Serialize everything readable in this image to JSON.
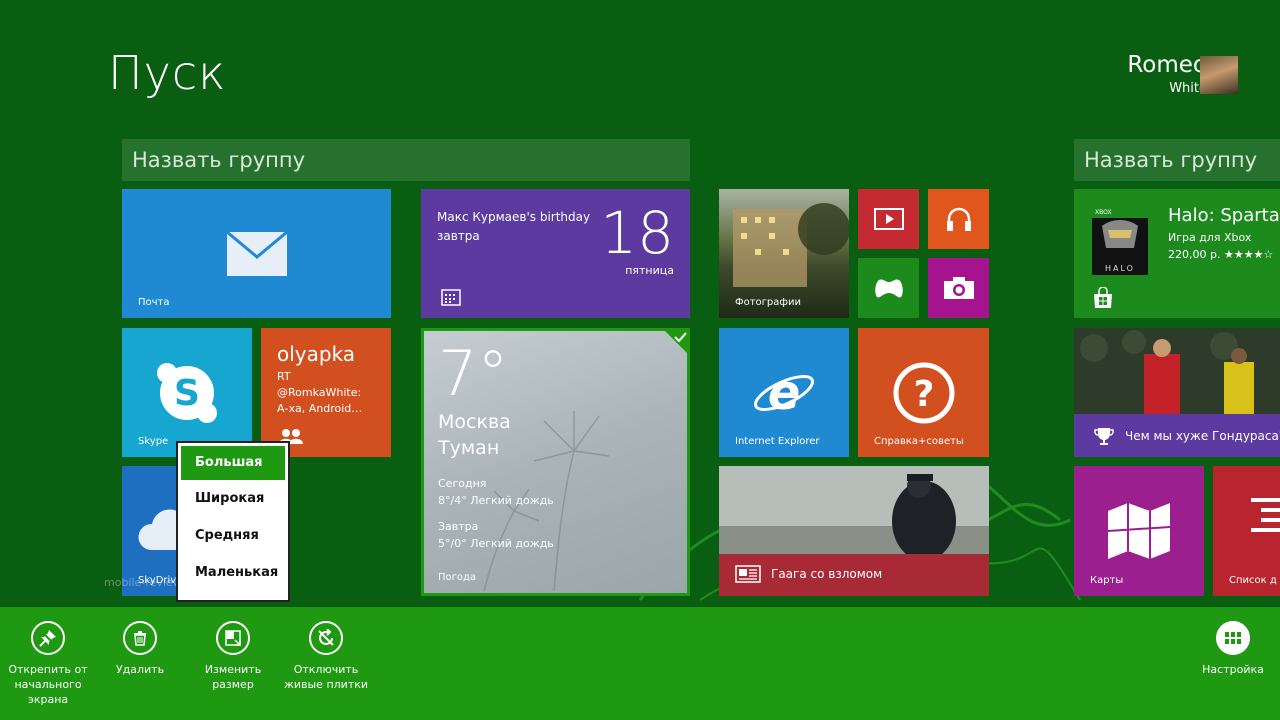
{
  "header": {
    "title": "Пуск",
    "user_first": "Romeo",
    "user_last": "White"
  },
  "groups": [
    {
      "label": "Назвать группу"
    },
    {
      "label": "Назвать группу"
    }
  ],
  "tiles": {
    "mail": {
      "name": "Почта",
      "color": "#1f8ad1"
    },
    "calendar": {
      "event": "Макс Курмаев's birthday",
      "when": "завтра",
      "day": "18",
      "weekday": "пятница",
      "color": "#5c3a9f"
    },
    "photos": {
      "name": "Фотографии"
    },
    "video": {
      "color": "#c42a32"
    },
    "music": {
      "color": "#e0561d"
    },
    "games": {
      "color": "#1d8a1d"
    },
    "camera": {
      "color": "#a5148e"
    },
    "halo": {
      "title": "Halo: Sparta",
      "subtitle": "Игра для Xbox",
      "price": "220,00 р.",
      "stars": "★★★★☆",
      "badge": "XBOX",
      "logo": "HALO",
      "color": "#1d8a1d"
    },
    "skype": {
      "name": "Skype",
      "color": "#17a6d0"
    },
    "people": {
      "title": "olyapka",
      "line1": "RT",
      "line2": "@RomkaWhite:",
      "line3": "А-ха, Android…",
      "color": "#d24f1f"
    },
    "weather": {
      "temp": "7°",
      "city": "Москва",
      "condition": "Туман",
      "today_label": "Сегодня",
      "today_text": "8°/4° Легкий дождь",
      "tomorrow_label": "Завтра",
      "tomorrow_text": "5°/0° Легкий дождь",
      "name": "Погода"
    },
    "ie": {
      "name": "Internet Explorer",
      "color": "#1f8ad1"
    },
    "help": {
      "name": "Справка+советы",
      "color": "#d24f1f"
    },
    "sports": {
      "headline": "Чем мы хуже Гондураса?",
      "color": "#5c3a9f"
    },
    "news": {
      "headline": "Гаага со взломом",
      "color": "#a72a36"
    },
    "maps": {
      "name": "Карты",
      "color": "#9b1f8e"
    },
    "readinglist": {
      "name": "Список д",
      "color": "#b8252f"
    },
    "skydrive": {
      "name": "SkyDrive",
      "color": "#1f6fc0"
    }
  },
  "watermark": "mobile-review.com",
  "resize_menu": {
    "items": [
      "Большая",
      "Широкая",
      "Средняя",
      "Маленькая"
    ],
    "selected": "Большая"
  },
  "appbar": {
    "unpin": "Открепить от начального экрана",
    "uninstall": "Удалить",
    "resize": "Изменить размер",
    "live_off": "Отключить живые плитки",
    "customize": "Настройка",
    "color": "#1e9911"
  }
}
